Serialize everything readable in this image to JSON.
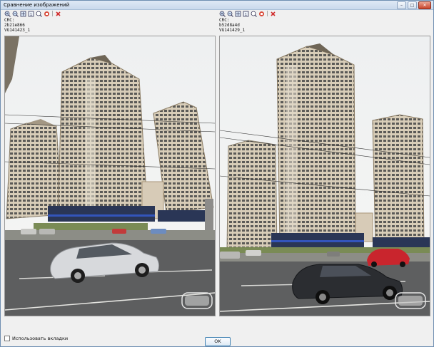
{
  "window": {
    "title": "Сравнение изображений"
  },
  "titlebar_buttons": [
    "minimize-icon",
    "maximize-icon",
    "close-icon"
  ],
  "left": {
    "crc": "CRC: 2b21e866",
    "name": "VG141423_1"
  },
  "right": {
    "crc": "CRC: b52d8a4d",
    "name": "VG141429_1"
  },
  "toolbar_icons": [
    "zoom-in-icon",
    "zoom-out-icon",
    "fit-icon",
    "actual-size-icon",
    "search-icon",
    "stop-icon",
    "delete-icon"
  ],
  "footer": {
    "checkbox_label": "Использовать вкладки",
    "ok_label": "OK"
  },
  "colors": {
    "accent": "#3c7fb1",
    "close": "#c8452b",
    "delete": "#d02a2a"
  }
}
